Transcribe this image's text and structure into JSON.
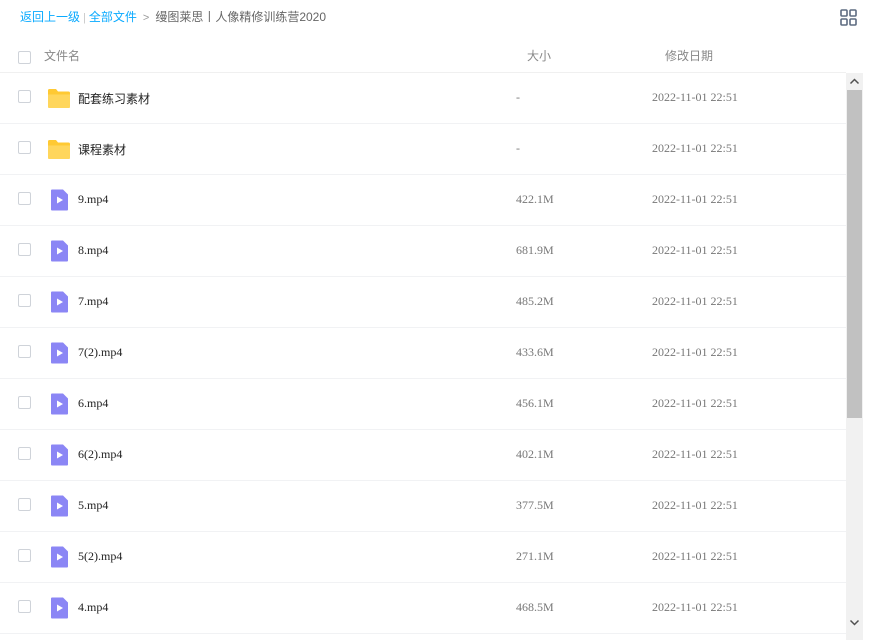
{
  "breadcrumb": {
    "back": "返回上一级",
    "all_files": "全部文件",
    "current": "缦图莱思丨人像精修训练营2020"
  },
  "columns": {
    "name": "文件名",
    "size": "大小",
    "modified": "修改日期"
  },
  "files": [
    {
      "name": "配套练习素材",
      "size": "-",
      "date": "2022-11-01 22:51",
      "type": "folder"
    },
    {
      "name": "课程素材",
      "size": "-",
      "date": "2022-11-01 22:51",
      "type": "folder"
    },
    {
      "name": "9.mp4",
      "size": "422.1M",
      "date": "2022-11-01 22:51",
      "type": "video"
    },
    {
      "name": "8.mp4",
      "size": "681.9M",
      "date": "2022-11-01 22:51",
      "type": "video"
    },
    {
      "name": "7.mp4",
      "size": "485.2M",
      "date": "2022-11-01 22:51",
      "type": "video"
    },
    {
      "name": "7(2).mp4",
      "size": "433.6M",
      "date": "2022-11-01 22:51",
      "type": "video"
    },
    {
      "name": "6.mp4",
      "size": "456.1M",
      "date": "2022-11-01 22:51",
      "type": "video"
    },
    {
      "name": "6(2).mp4",
      "size": "402.1M",
      "date": "2022-11-01 22:51",
      "type": "video"
    },
    {
      "name": "5.mp4",
      "size": "377.5M",
      "date": "2022-11-01 22:51",
      "type": "video"
    },
    {
      "name": "5(2).mp4",
      "size": "271.1M",
      "date": "2022-11-01 22:51",
      "type": "video"
    },
    {
      "name": "4.mp4",
      "size": "468.5M",
      "date": "2022-11-01 22:51",
      "type": "video"
    }
  ],
  "icons": {
    "folder": "folder-icon",
    "video": "video-file-icon",
    "view_toggle": "grid-view-icon"
  },
  "colors": {
    "link": "#09aaff",
    "folder": "#ffc933",
    "video": "#8b86f5"
  }
}
